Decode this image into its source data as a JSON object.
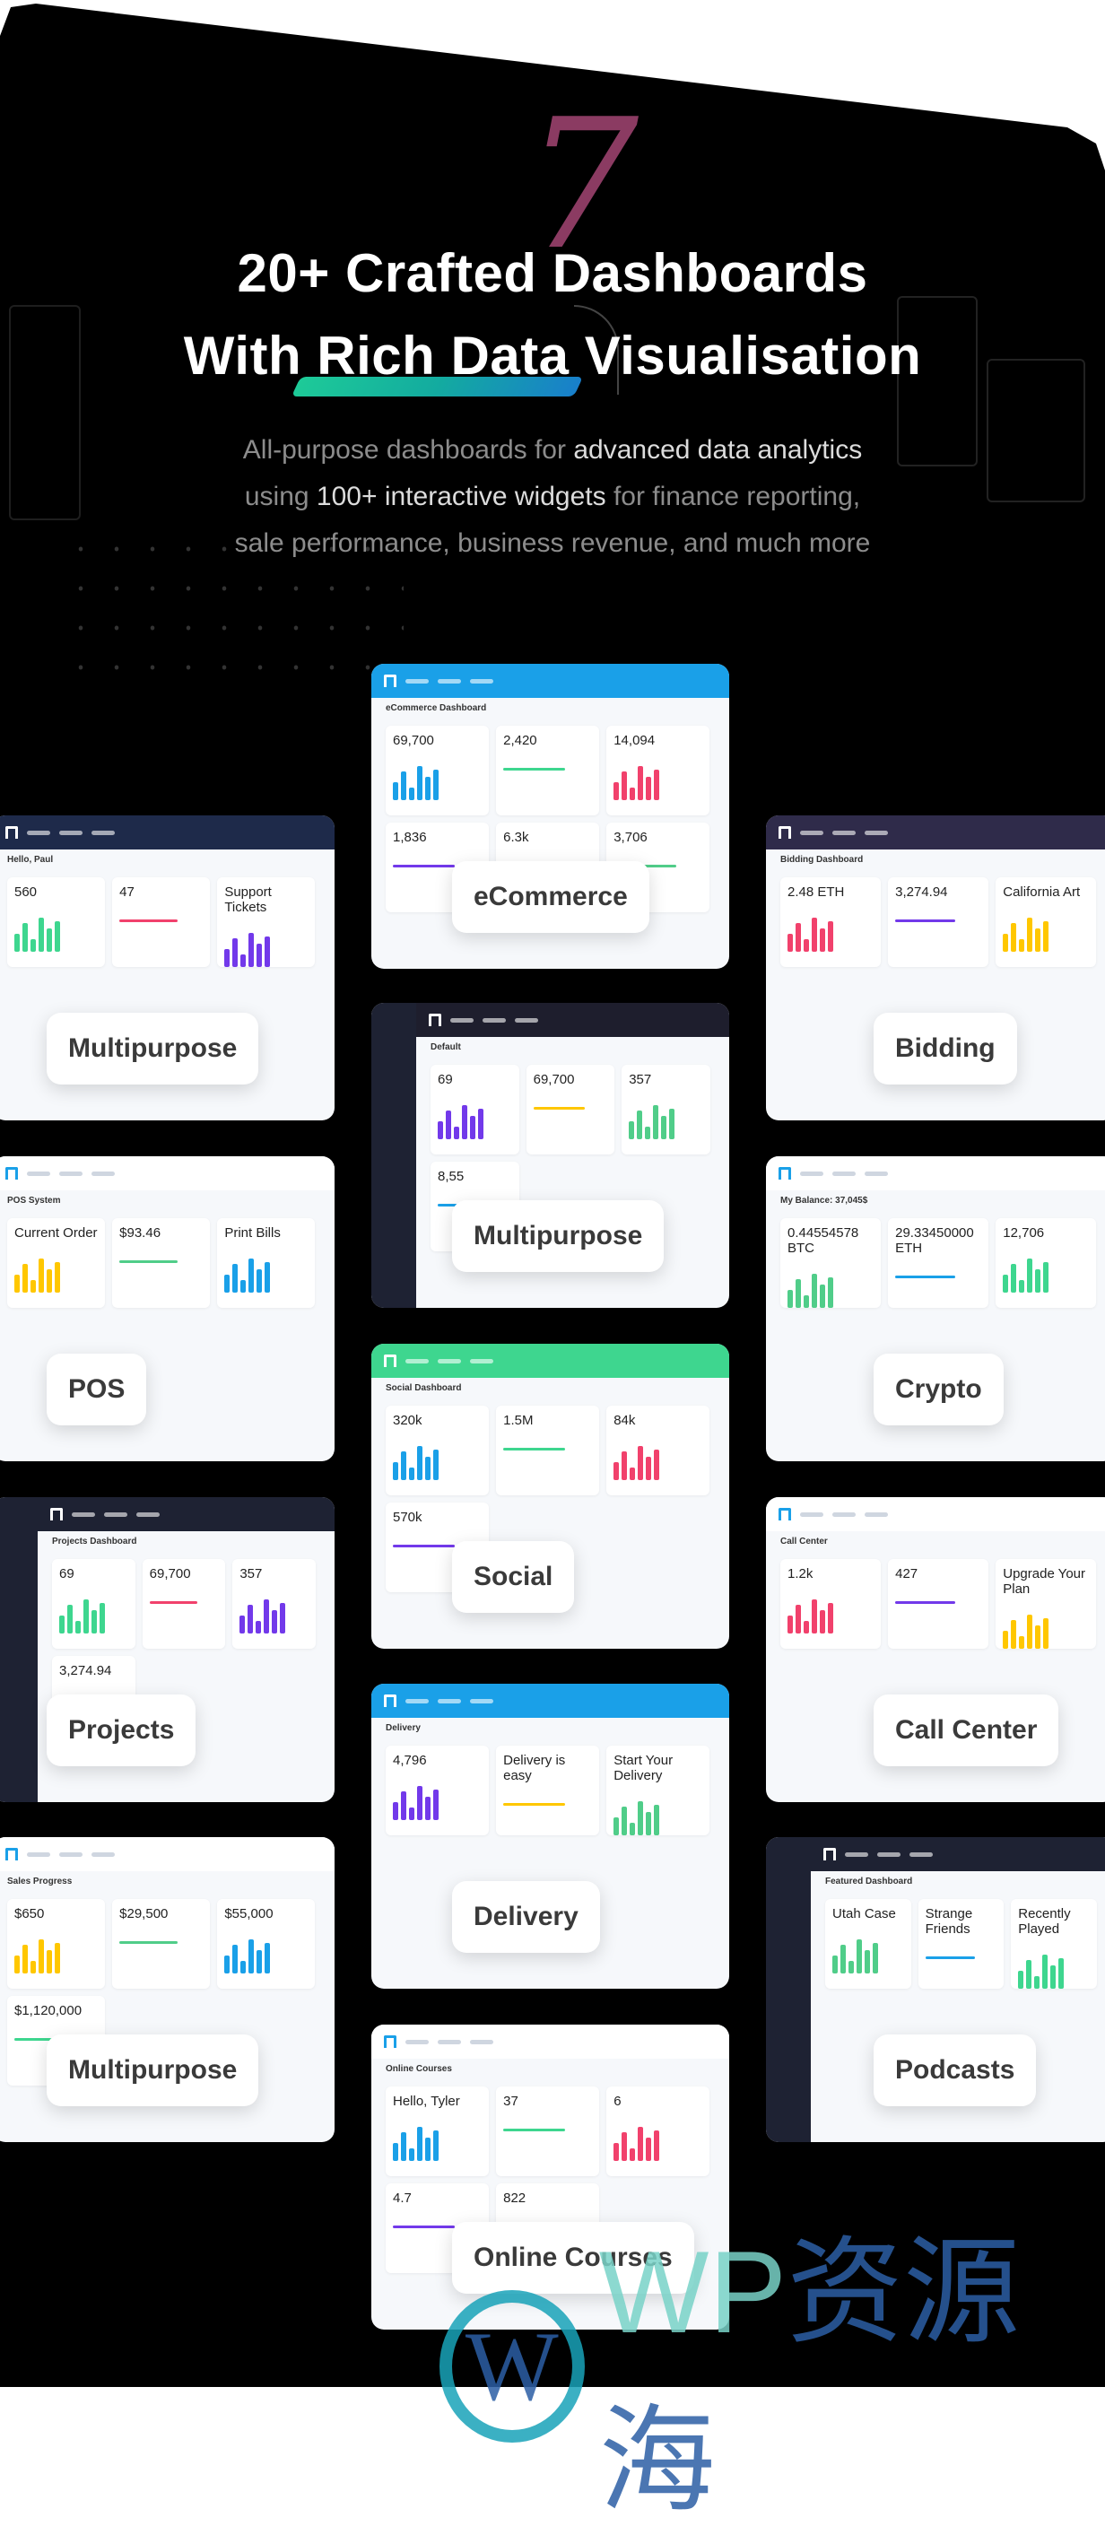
{
  "hero": {
    "decoration_numeral": "7",
    "title_line1": "20+ Crafted Dashboards",
    "title_line2": "With Rich Data Visualisation",
    "subtitle": [
      [
        {
          "t": "All-purpose dashboards for ",
          "hl": false
        },
        {
          "t": "advanced data analytics",
          "hl": true
        }
      ],
      [
        {
          "t": "using ",
          "hl": false
        },
        {
          "t": "100+ interactive widgets",
          "hl": true
        },
        {
          "t": " for finance reporting,",
          "hl": false
        }
      ],
      [
        {
          "t": "sale performance, business revenue, and much more",
          "hl": false
        }
      ]
    ]
  },
  "cards": [
    {
      "label": "eCommerce",
      "header": "eCommerce Dashboard",
      "accent": "#1aa0e8",
      "stats": [
        "69,700",
        "2,420",
        "14,094",
        "1,836",
        "6.3k",
        "3,706"
      ]
    },
    {
      "label": "Multipurpose",
      "header": "Hello, Paul",
      "accent": "#1e2a4a",
      "stats": [
        "560",
        "47",
        "Support Tickets"
      ]
    },
    {
      "label": "Bidding",
      "header": "Bidding Dashboard",
      "accent": "#2f2b4a",
      "stats": [
        "2.48 ETH",
        "3,274.94",
        "California Art"
      ]
    },
    {
      "label": "Multipurpose",
      "header": "Default",
      "accent": "#1e1e2d",
      "stats": [
        "69",
        "69,700",
        "357",
        "8,55"
      ]
    },
    {
      "label": "POS",
      "header": "POS System",
      "accent": "#ffffff",
      "stats": [
        "Current Order",
        "$93.46",
        "Print Bills"
      ]
    },
    {
      "label": "Crypto",
      "header": "My Balance: 37,045$",
      "accent": "#f7f1e8",
      "stats": [
        "0.44554578 BTC",
        "29.33450000 ETH",
        "12,706"
      ]
    },
    {
      "label": "Social",
      "header": "Social Dashboard",
      "accent": "#3ed68f",
      "stats": [
        "320k",
        "1.5M",
        "84k",
        "570k"
      ]
    },
    {
      "label": "Projects",
      "header": "Projects Dashboard",
      "accent": "#1e2233",
      "stats": [
        "69",
        "69,700",
        "357",
        "3,274.94"
      ]
    },
    {
      "label": "Call Center",
      "header": "Call Center",
      "accent": "#ffffff",
      "stats": [
        "1.2k",
        "427",
        "Upgrade Your Plan"
      ]
    },
    {
      "label": "Delivery",
      "header": "Delivery",
      "accent": "#1aa0e8",
      "stats": [
        "4,796",
        "Delivery is easy",
        "Start Your Delivery"
      ]
    },
    {
      "label": "Multipurpose",
      "header": "Sales Progress",
      "accent": "#ffffff",
      "stats": [
        "$650",
        "$29,500",
        "$55,000",
        "$1,120,000"
      ]
    },
    {
      "label": "Podcasts",
      "header": "Featured Dashboard",
      "accent": "#1e2233",
      "stats": [
        "Utah Case",
        "Strange Friends",
        "Recently Played"
      ]
    },
    {
      "label": "Online Courses",
      "header": "Online Courses",
      "accent": "#ffffff",
      "stats": [
        "Hello, Tyler",
        "37",
        "6",
        "4.7",
        "822"
      ]
    }
  ],
  "watermark": "WP资源海"
}
